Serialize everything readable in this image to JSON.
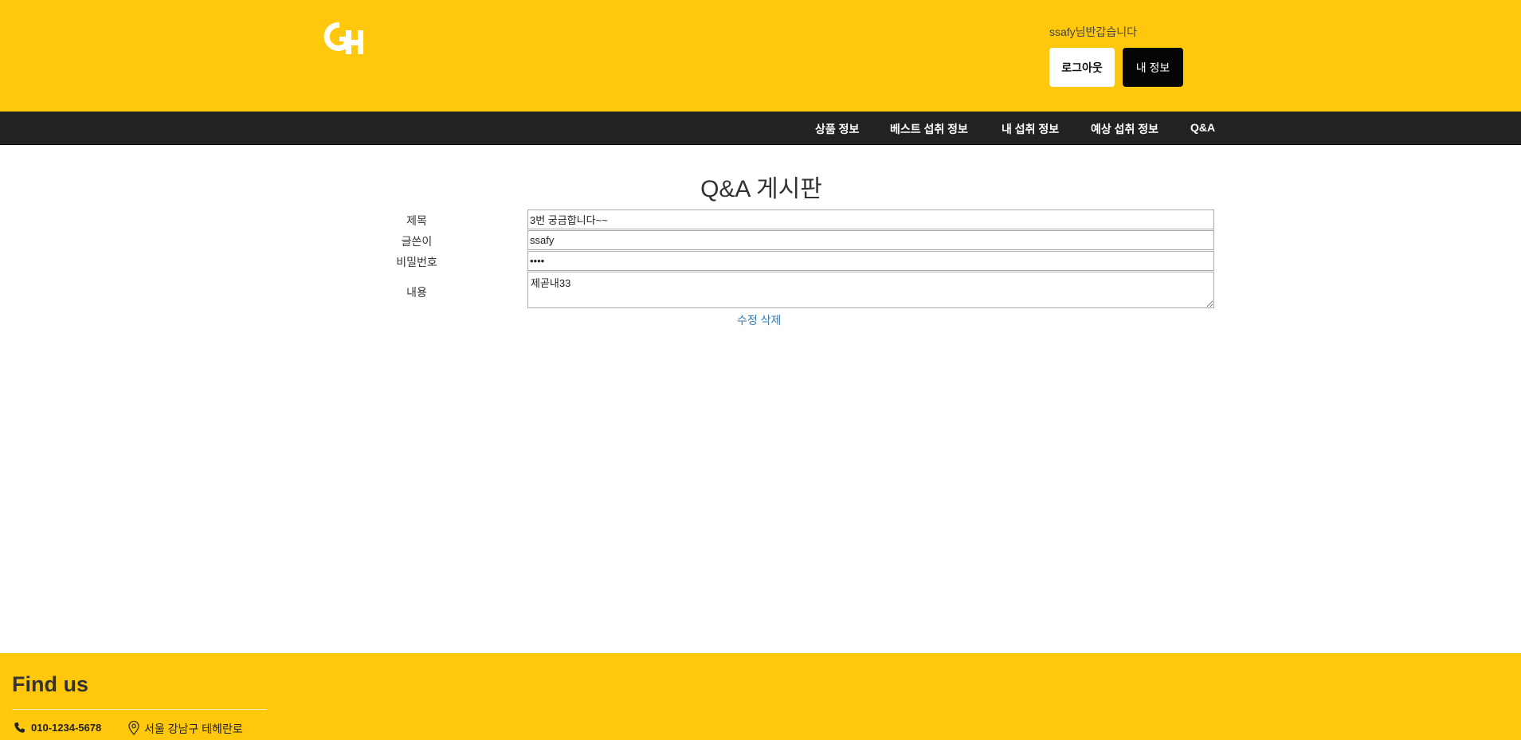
{
  "header": {
    "logo_text": "GH",
    "greeting": "ssafy님반갑습니다",
    "logout_label": "로그아웃",
    "myinfo_label": "내 정보",
    "brand_color": "#ffc80c"
  },
  "nav": {
    "items": [
      {
        "label": "상품 정보"
      },
      {
        "label": "베스트 섭취 정보"
      },
      {
        "label": "내 섭취 정보"
      },
      {
        "label": "예상 섭취 정보"
      },
      {
        "label": "Q&A"
      }
    ]
  },
  "board": {
    "title": "Q&A 게시판",
    "fields": {
      "title_label": "제목",
      "title_value": "3번 궁금합니다~~",
      "author_label": "글쓴이",
      "author_value": "ssafy",
      "password_label": "비밀번호",
      "password_value": "1234",
      "content_label": "내용",
      "content_value": "제곧내33"
    },
    "edit_label": "수정",
    "delete_label": "삭제",
    "link_color": "#337ab7"
  },
  "footer": {
    "title": "Find us",
    "phone": "010-1234-5678",
    "address": "서울 강남구 테헤란로",
    "phone_icon": "phone-icon",
    "address_icon": "map-pin-icon"
  }
}
